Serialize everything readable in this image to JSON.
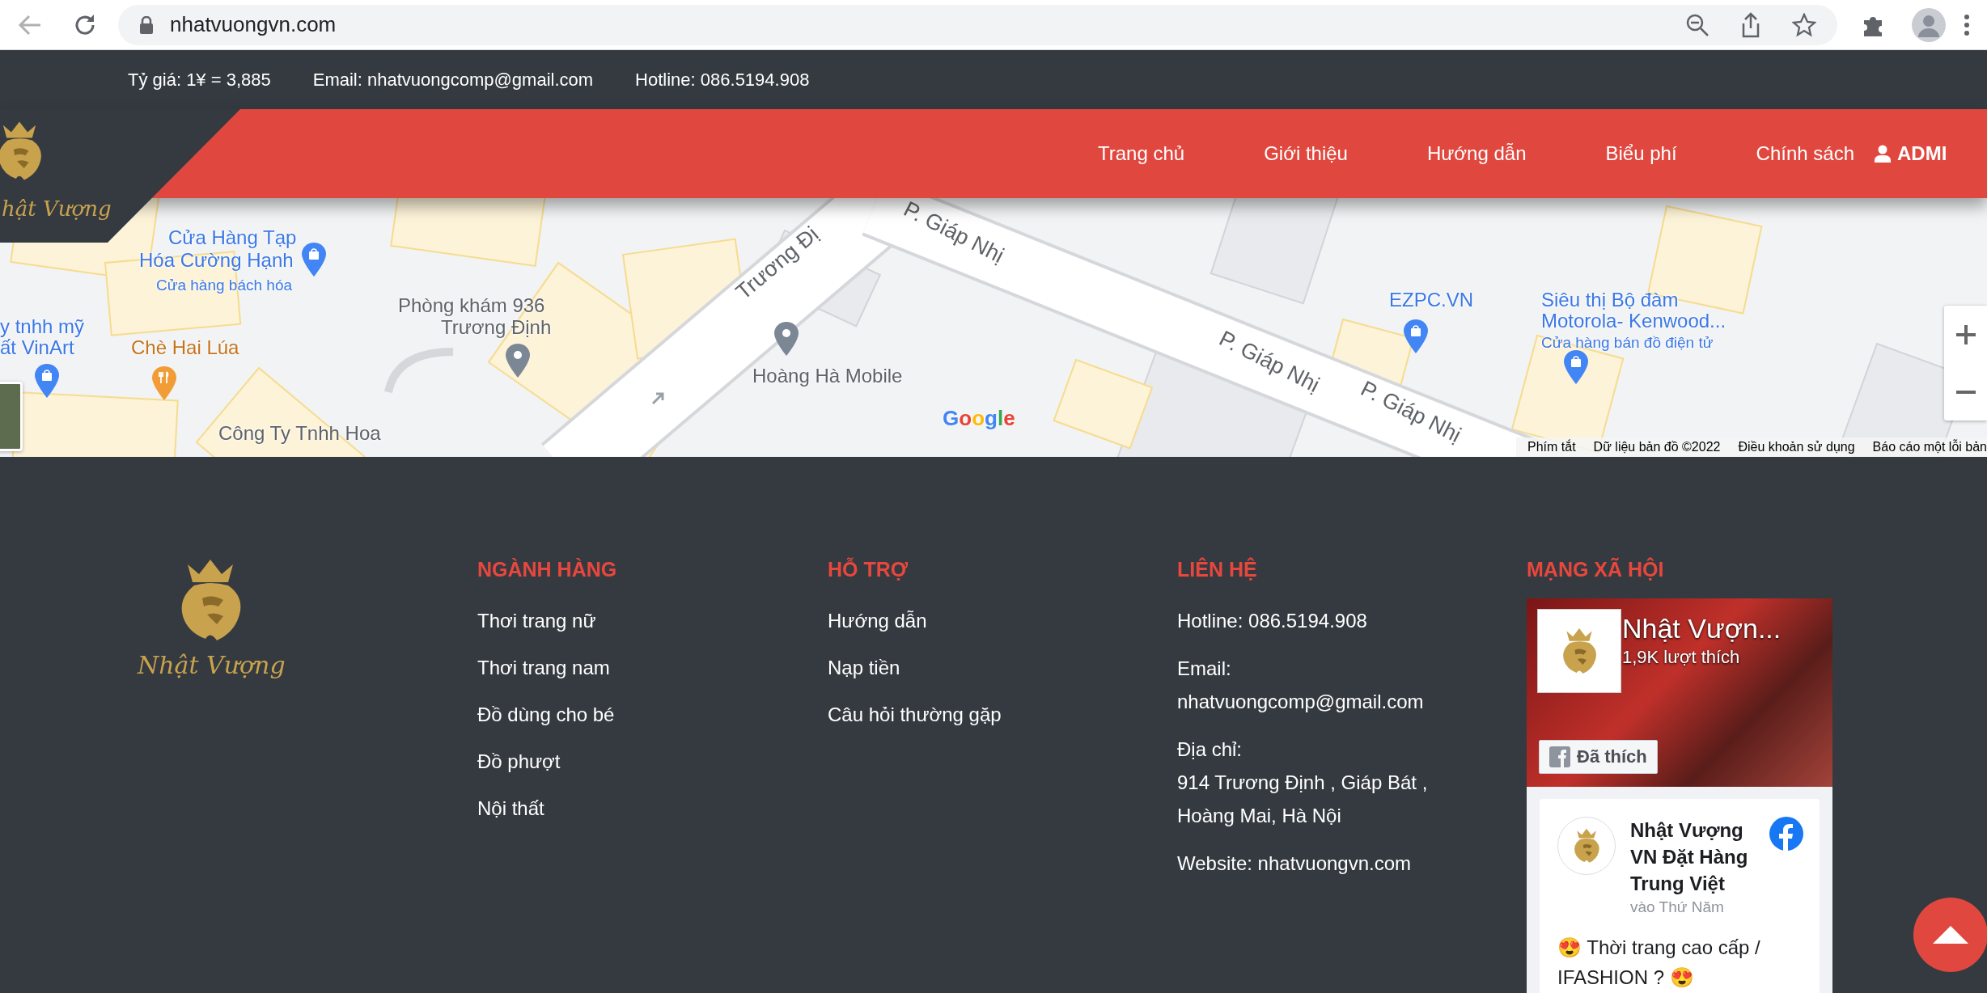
{
  "browser": {
    "url": "nhatvuongvn.com"
  },
  "top_bar": {
    "items": [
      "Tỷ giá: 1¥ = 3,885",
      "Email: nhatvuongcomp@gmail.com",
      "Hotline: 086.5194.908"
    ]
  },
  "header": {
    "logo_text": "hật Vượng",
    "nav": [
      {
        "label": "Trang chủ"
      },
      {
        "label": "Giới thiệu"
      },
      {
        "label": "Hướng dẫn"
      },
      {
        "label": "Biểu phí"
      },
      {
        "label": "Chính sách"
      }
    ],
    "account": "ADMI"
  },
  "map": {
    "labels": [
      {
        "text": "P. Giáp Nhị",
        "kind": "road"
      },
      {
        "text": "Cửa Hàng Tạp",
        "kind": "shop"
      },
      {
        "text": "Hóa Cường Hạnh",
        "kind": "shop"
      },
      {
        "text": "Cửa hàng bách hóa",
        "kind": "category"
      },
      {
        "text": "Phòng khám 936",
        "kind": "place"
      },
      {
        "text": "Trương Đị",
        "kind": "road"
      },
      {
        "text": "EZPC.VN",
        "kind": "shop"
      },
      {
        "text": "Siêu thị Bộ đàm",
        "kind": "shop"
      },
      {
        "text": "y tnhh mỹ",
        "kind": "shop"
      },
      {
        "text": "Trương Định",
        "kind": "place"
      },
      {
        "text": "Motorola- Kenwood...",
        "kind": "shop"
      },
      {
        "text": "ất VinArt",
        "kind": "shop"
      },
      {
        "text": "Chè Hai Lúa",
        "kind": "food"
      },
      {
        "text": "P. Giáp Nhị",
        "kind": "road"
      },
      {
        "text": "Cửa hàng bán đồ điện tử",
        "kind": "category"
      },
      {
        "text": "Hoàng Hà Mobile",
        "kind": "place"
      },
      {
        "text": "P. Giáp Nhị",
        "kind": "road"
      },
      {
        "text": "Công Ty Tnhh Hoa",
        "kind": "place"
      }
    ],
    "google": "Google",
    "attribution": [
      "Phím tắt",
      "Dữ liệu bản đồ ©2022",
      "Điều khoản sử dụng",
      "Báo cáo một lỗi bản"
    ]
  },
  "footer": {
    "logo_text": "Nhật Vượng",
    "columns": [
      {
        "heading": "NGÀNH HÀNG",
        "kind": "links",
        "items": [
          "Thơi trang nữ",
          "Thơi trang nam",
          "Đồ dùng cho bé",
          "Đồ phượt",
          "Nội thất"
        ]
      },
      {
        "heading": "HỖ TRỢ",
        "kind": "links",
        "items": [
          "Hướng dẫn",
          "Nạp tiền",
          "Câu hỏi thường gặp"
        ]
      },
      {
        "heading": "LIÊN HỆ",
        "kind": "contact",
        "paragraphs": [
          [
            "Hotline: 086.5194.908"
          ],
          [
            "Email:",
            "nhatvuongcomp@gmail.com"
          ],
          [
            "Địa chỉ:",
            "914 Trương Định , Giáp Bát ,",
            "Hoàng Mai, Hà Nội"
          ],
          [
            "Website: nhatvuongvn.com"
          ]
        ]
      },
      {
        "heading": "MẠNG XÃ HỘI",
        "kind": "social",
        "page_name": "Nhật Vượn...",
        "likes": "1,9K lượt thích",
        "like_button": "Đã thích",
        "post": {
          "author": "Nhật Vượng VN Đặt Hàng Trung Việt",
          "time": "vào Thứ Năm",
          "text": "😍 Thời trang cao cấp / IFASHION ? 😍"
        }
      }
    ]
  }
}
